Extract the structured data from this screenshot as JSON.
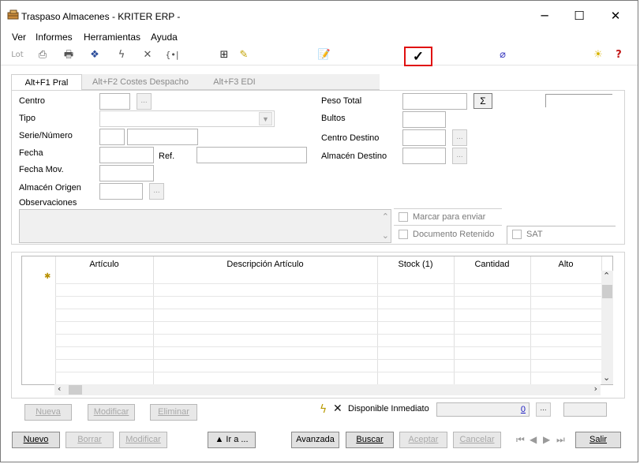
{
  "window": {
    "title": "Traspaso Almacenes - KRITER ERP -",
    "minimize": "─",
    "maximize": "☐",
    "close": "✕"
  },
  "menu": [
    "Ver",
    "Informes",
    "Herramientas",
    "Ayuda"
  ],
  "toolbar": {
    "lot_label": "Lot",
    "highlighted_check": "✓"
  },
  "tabs": [
    "Alt+F1 Pral",
    "Alt+F2 Costes Despacho",
    "Alt+F3 EDI"
  ],
  "form": {
    "centro": "Centro",
    "tipo": "Tipo",
    "serie_numero": "Serie/Número",
    "fecha": "Fecha",
    "ref": "Ref.",
    "fecha_mov": "Fecha Mov.",
    "almacen_origen": "Almacén Origen",
    "observaciones": "Observaciones",
    "peso_total": "Peso Total",
    "sigma": "Σ",
    "bultos": "Bultos",
    "centro_destino": "Centro Destino",
    "almacen_destino": "Almacén Destino",
    "ellipsis": "...",
    "marcar_para_enviar": "Marcar para enviar",
    "documento_retenido": "Documento Retenido",
    "sat": "SAT"
  },
  "grid": {
    "columns": [
      "Artículo",
      "Descripción Artículo",
      "Stock (1)",
      "Cantidad",
      "Alto"
    ]
  },
  "grid_buttons": {
    "nueva": "Nueva",
    "modificar": "Modificar",
    "eliminar": "Eliminar"
  },
  "disponible": {
    "label": "Disponible Inmediato",
    "value": "0",
    "ellipsis": "..."
  },
  "bottom_buttons": {
    "nuevo": "Nuevo",
    "borrar": "Borrar",
    "modificar": "Modificar",
    "ir_a": "▲ Ir a ...",
    "avanzada": "Avanzada",
    "buscar": "Buscar",
    "aceptar": "Aceptar",
    "cancelar": "Cancelar",
    "salir": "Salir"
  }
}
